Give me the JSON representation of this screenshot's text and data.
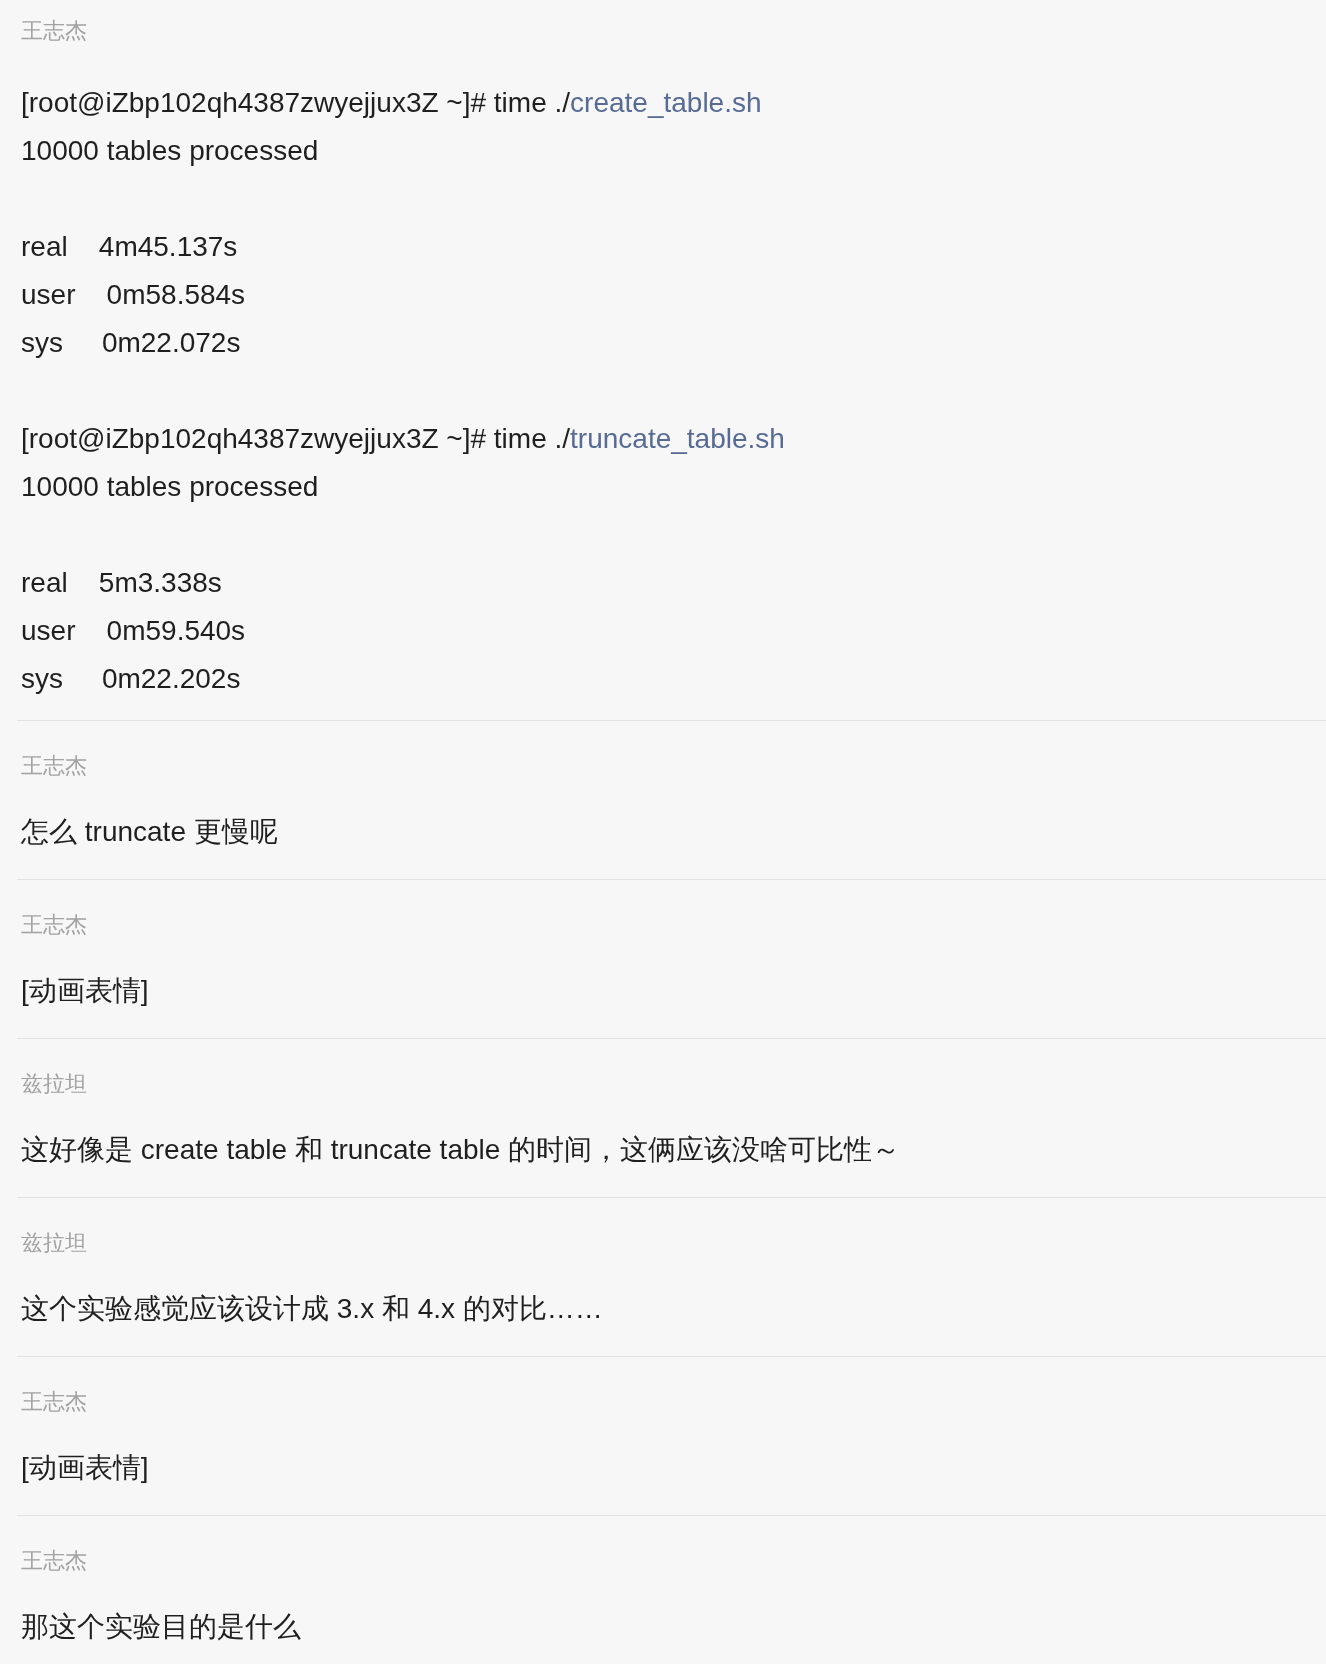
{
  "messages": [
    {
      "sender": "王志杰",
      "lines": [
        {
          "kind": "text",
          "text": "[root@iZbp102qh4387zwyejjux3Z ~]# time ./",
          "link": "create_table.sh"
        },
        {
          "kind": "text",
          "text": "10000 tables processed"
        },
        {
          "kind": "blank"
        },
        {
          "kind": "text",
          "text": "real    4m45.137s"
        },
        {
          "kind": "text",
          "text": "user    0m58.584s"
        },
        {
          "kind": "text",
          "text": "sys     0m22.072s"
        },
        {
          "kind": "blank"
        },
        {
          "kind": "text",
          "text": "[root@iZbp102qh4387zwyejjux3Z ~]# time ./",
          "link": "truncate_table.sh"
        },
        {
          "kind": "text",
          "text": "10000 tables processed"
        },
        {
          "kind": "blank"
        },
        {
          "kind": "text",
          "text": "real    5m3.338s"
        },
        {
          "kind": "text",
          "text": "user    0m59.540s"
        },
        {
          "kind": "text",
          "text": "sys     0m22.202s"
        }
      ]
    },
    {
      "sender": "王志杰",
      "lines": [
        {
          "kind": "text",
          "text": "怎么 truncate 更慢呢"
        }
      ]
    },
    {
      "sender": "王志杰",
      "lines": [
        {
          "kind": "text",
          "text": "[动画表情]"
        }
      ]
    },
    {
      "sender": "兹拉坦",
      "lines": [
        {
          "kind": "text",
          "text": "这好像是 create table 和 truncate table 的时间，这俩应该没啥可比性～"
        }
      ]
    },
    {
      "sender": "兹拉坦",
      "lines": [
        {
          "kind": "text",
          "text": "这个实验感觉应该设计成 3.x 和 4.x 的对比……"
        }
      ]
    },
    {
      "sender": "王志杰",
      "lines": [
        {
          "kind": "text",
          "text": "[动画表情]"
        }
      ]
    },
    {
      "sender": "王志杰",
      "lines": [
        {
          "kind": "text",
          "text": "那这个实验目的是什么"
        }
      ]
    }
  ]
}
